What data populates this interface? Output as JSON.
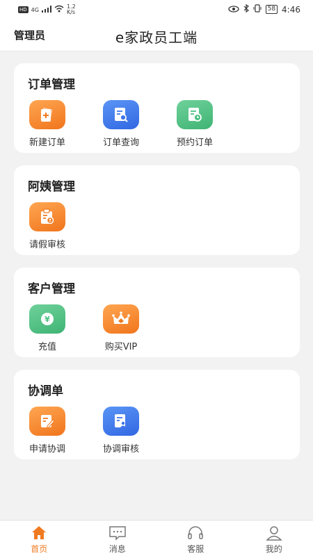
{
  "status": {
    "hd": "HD",
    "network": "4G",
    "speed_value": "1.2",
    "speed_unit": "K/s",
    "battery": "58",
    "time": "4:46"
  },
  "header": {
    "left_label": "管理员",
    "title": "e家政员工端"
  },
  "sections": [
    {
      "title": "订单管理",
      "items": [
        {
          "label": "新建订单",
          "icon": "add-order-icon",
          "color": "orange"
        },
        {
          "label": "订单查询",
          "icon": "order-search-icon",
          "color": "blue"
        },
        {
          "label": "预约订单",
          "icon": "appointment-order-icon",
          "color": "green"
        }
      ]
    },
    {
      "title": "阿姨管理",
      "items": [
        {
          "label": "请假审核",
          "icon": "leave-review-icon",
          "color": "orange"
        }
      ]
    },
    {
      "title": "客户管理",
      "items": [
        {
          "label": "充值",
          "icon": "recharge-icon",
          "color": "green"
        },
        {
          "label": "购买VIP",
          "icon": "vip-crown-icon",
          "color": "orange"
        }
      ]
    },
    {
      "title": "协调单",
      "items": [
        {
          "label": "申请协调",
          "icon": "apply-coordination-icon",
          "color": "orange"
        },
        {
          "label": "协调审核",
          "icon": "coordination-review-icon",
          "color": "blue"
        }
      ]
    }
  ],
  "tabs": [
    {
      "label": "首页",
      "icon": "home-icon",
      "active": true
    },
    {
      "label": "消息",
      "icon": "message-icon",
      "active": false
    },
    {
      "label": "客服",
      "icon": "headset-icon",
      "active": false
    },
    {
      "label": "我的",
      "icon": "user-icon",
      "active": false
    }
  ],
  "colors": {
    "accent": "#f07a20",
    "orange": "#f58a35",
    "blue": "#3f75eb",
    "green": "#4cc083",
    "background": "#f2f2f2"
  }
}
